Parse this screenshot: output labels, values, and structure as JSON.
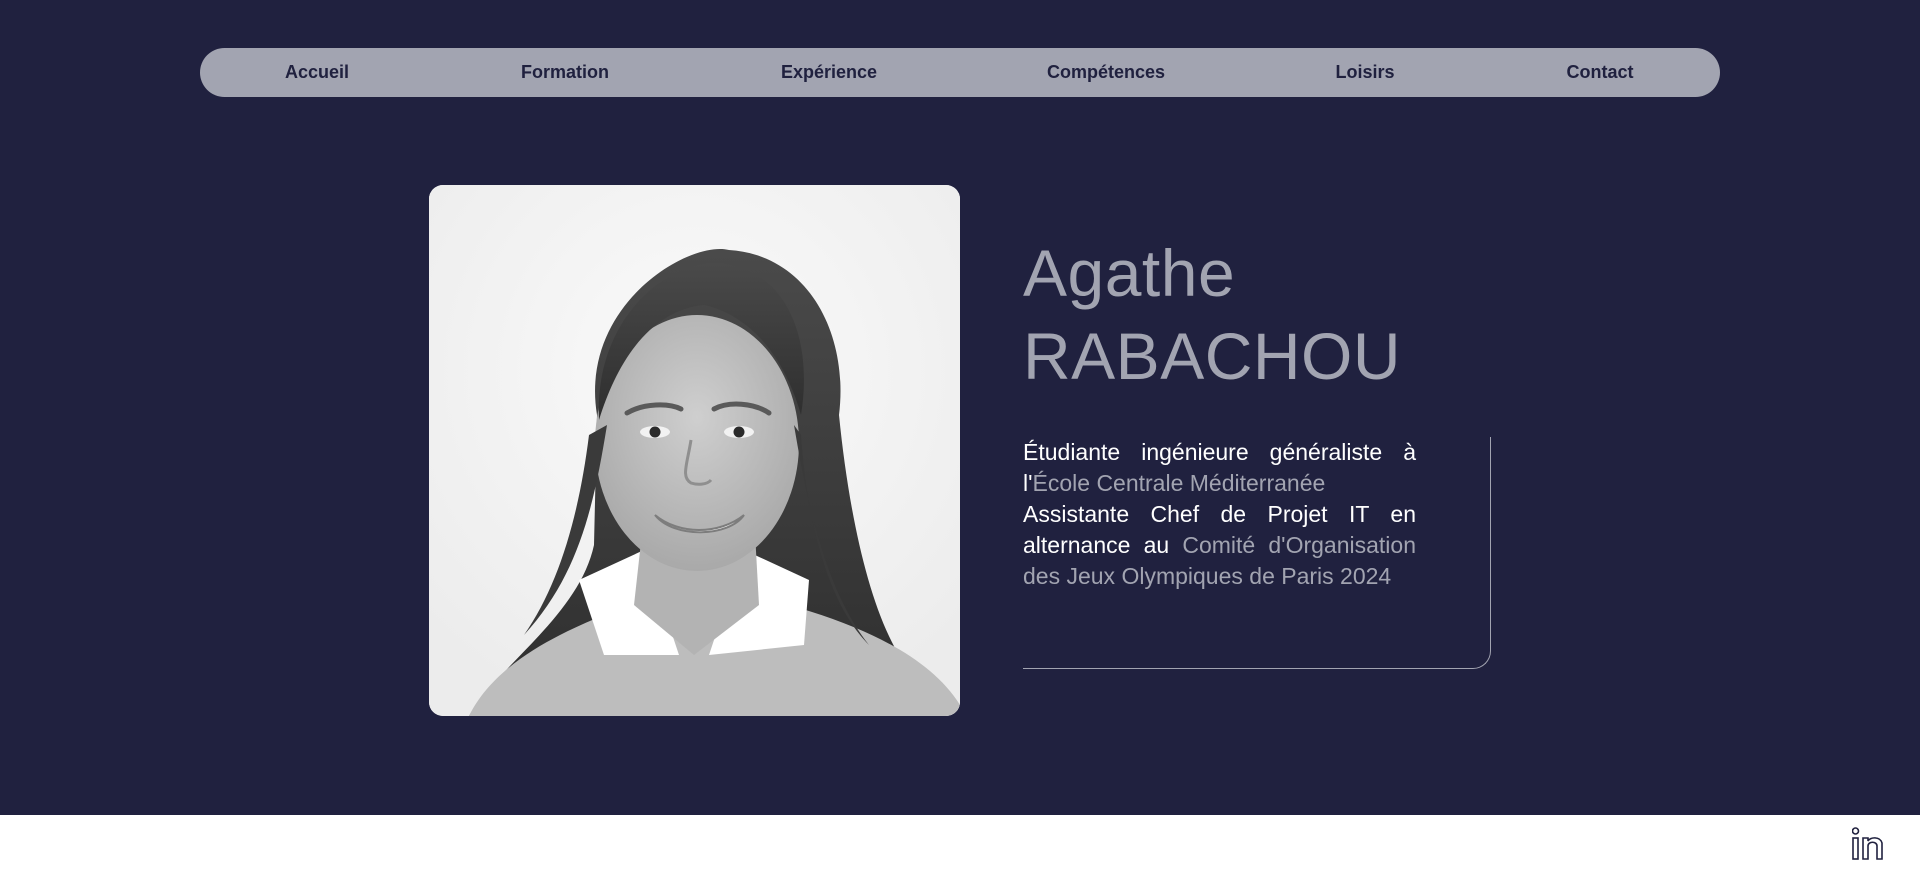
{
  "nav": {
    "items": [
      {
        "label": "Accueil"
      },
      {
        "label": "Formation"
      },
      {
        "label": "Expérience"
      },
      {
        "label": "Compétences"
      },
      {
        "label": "Loisirs"
      },
      {
        "label": "Contact"
      }
    ]
  },
  "profile": {
    "first_name": "Agathe",
    "last_name": "RABACHOU",
    "bio": {
      "line1_prefix": "Étudiante ingénieure généraliste à l'",
      "line1_school": "École Centrale Méditerranée",
      "line2_prefix": "Assistante Chef de Projet IT en alternance au ",
      "line2_org": "Comité d'Organisation des Jeux Olympiques de Paris 2024"
    }
  },
  "footer": {
    "social_icon": "linkedin-icon"
  },
  "colors": {
    "background": "#20213f",
    "nav_bar": "#a2a4b1",
    "accent_text": "#a2a4b1",
    "primary_text": "#ffffff",
    "footer_background": "#ffffff"
  }
}
